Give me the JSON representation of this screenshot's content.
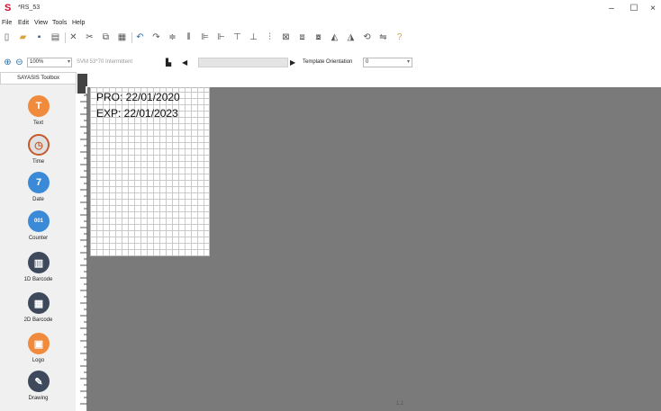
{
  "window": {
    "app_logo": "S",
    "title": "*RS_53",
    "controls": {
      "minimize": "–",
      "maximize": "☐",
      "close": "×"
    }
  },
  "menu": [
    "File",
    "Edit",
    "View",
    "Tools",
    "Help"
  ],
  "toolbar": {
    "zoom_value": "100%",
    "printer": "SVM 53*70 Intermittent",
    "template_orientation_label": "Template Orientation",
    "template_orientation_value": "0"
  },
  "toolbox": {
    "header": "SAYASIS Toolbox",
    "tools": [
      {
        "label": "Text",
        "icon": "text-icon",
        "color": "#f08a3c",
        "glyph": "T"
      },
      {
        "label": "Time",
        "icon": "clock-icon",
        "color": "#c9c9c9",
        "glyph": "◷"
      },
      {
        "label": "Date",
        "icon": "calendar-icon",
        "color": "#3b8ad8",
        "glyph": "7"
      },
      {
        "label": "Counter",
        "icon": "counter-icon",
        "color": "#3b8ad8",
        "glyph": "0 0 1"
      },
      {
        "label": "1D Barcode",
        "icon": "barcode-1d-icon",
        "color": "#3e4a5c",
        "glyph": "▥"
      },
      {
        "label": "2D Barcode",
        "icon": "barcode-2d-icon",
        "color": "#3e4a5c",
        "glyph": "▦"
      },
      {
        "label": "Logo",
        "icon": "image-icon",
        "color": "#f08a3c",
        "glyph": "▣"
      },
      {
        "label": "Drawing",
        "icon": "drawing-icon",
        "color": "#3e4a5c",
        "glyph": "✎"
      }
    ]
  },
  "canvas": {
    "line1": "PRO: 22/01/2020",
    "line2": "EXP: 22/01/2023"
  },
  "status": {
    "text": "1,1"
  }
}
